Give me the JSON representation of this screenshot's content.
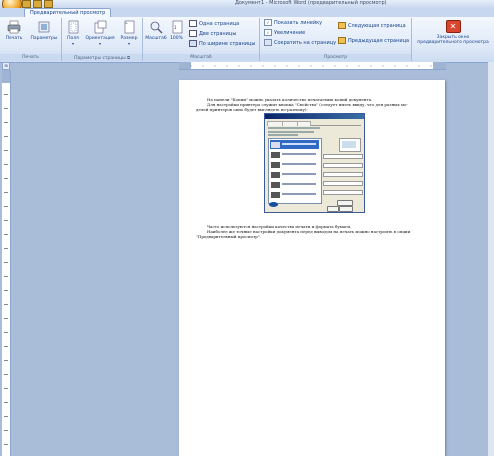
{
  "window": {
    "title": "Документ1 - Microsoft Word (предварительный просмотр)"
  },
  "tabs": [
    {
      "label": "Предварительный просмотр"
    }
  ],
  "ribbon": {
    "print_group": {
      "label": "Печать",
      "print": "Печать",
      "options": "Параметры"
    },
    "page_setup_group": {
      "label": "Параметры страницы",
      "margins": "Поля",
      "orientation": "Ориентация",
      "size": "Размер"
    },
    "zoom_group": {
      "label": "Масштаб",
      "zoom": "Масштаб",
      "hundred": "100%",
      "one_page": "Одна страница",
      "two_pages": "Две страницы",
      "page_width": "По ширине страницы"
    },
    "preview_group": {
      "label": "Просмотр",
      "show_ruler": "Показать линейку",
      "magnifier": "Увеличение",
      "shrink": "Сократить на страницу",
      "next_page": "Следующая страница",
      "prev_page": "Предыдущая страница"
    },
    "close_group": {
      "close": "Закрыть окно предварительного просмотра"
    }
  },
  "document": {
    "lines": [
      "На панели \"Копии\" можно указать количество печатаемых копий документа.",
      "Для настройки принтера служит кнопка \"Свойства\" (следует иметь ввиду, что для разных мо-",
      "делей принтеров окно будет выглядеть по-разному):",
      "Часто используются настройки качества печати и формата бумаги.",
      "Наиболее же точные настройки документа перед выводом на печать можно настроить в опции",
      "\"Предварительный просмотр\"."
    ]
  },
  "colors": {
    "ribbon_text": "#15428b",
    "workspace": "#a9bcd8",
    "close_red": "#d9462f"
  }
}
